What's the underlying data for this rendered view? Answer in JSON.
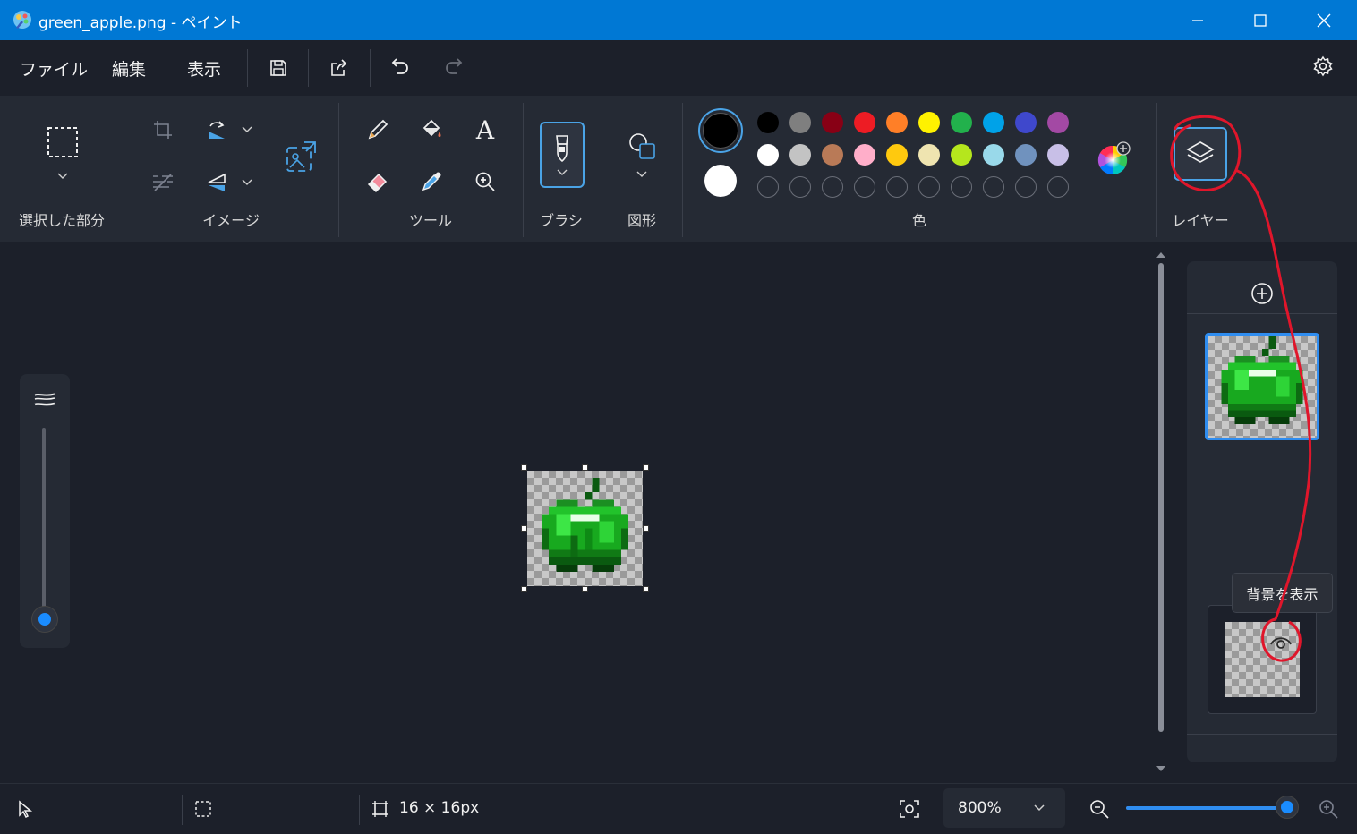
{
  "window": {
    "title": "green_apple.png - ペイント",
    "controls": [
      "minimize",
      "maximize",
      "close"
    ]
  },
  "menu": {
    "file": "ファイル",
    "edit": "編集",
    "view": "表示"
  },
  "ribbon": {
    "groups": {
      "selection": "選択した部分",
      "image": "イメージ",
      "tools": "ツール",
      "brush": "ブラシ",
      "shapes": "図形",
      "colors": "色",
      "layers": "レイヤー"
    },
    "text_tool_glyph": "A"
  },
  "colors": {
    "primary": "#000000",
    "secondary": "#ffffff",
    "palette_row1": [
      "#000000",
      "#7f7f7f",
      "#880015",
      "#ed1c24",
      "#ff7f27",
      "#fff200",
      "#22b14c",
      "#00a2e8",
      "#3f48cc",
      "#a349a4"
    ],
    "palette_row2": [
      "#ffffff",
      "#c3c3c3",
      "#b97a57",
      "#ffaec9",
      "#ffc90e",
      "#efe4b0",
      "#b5e61d",
      "#99d9ea",
      "#7092be",
      "#c8bfe7"
    ],
    "custom_slots": 10,
    "accent": "#0078d4",
    "annotation": "#e0162b"
  },
  "tooltip": "背景を表示",
  "status": {
    "canvas_size": "16 × 16px",
    "zoom": "800%",
    "zoom_slider_fraction": 0.99,
    "brush_size_fraction": 0.0
  }
}
